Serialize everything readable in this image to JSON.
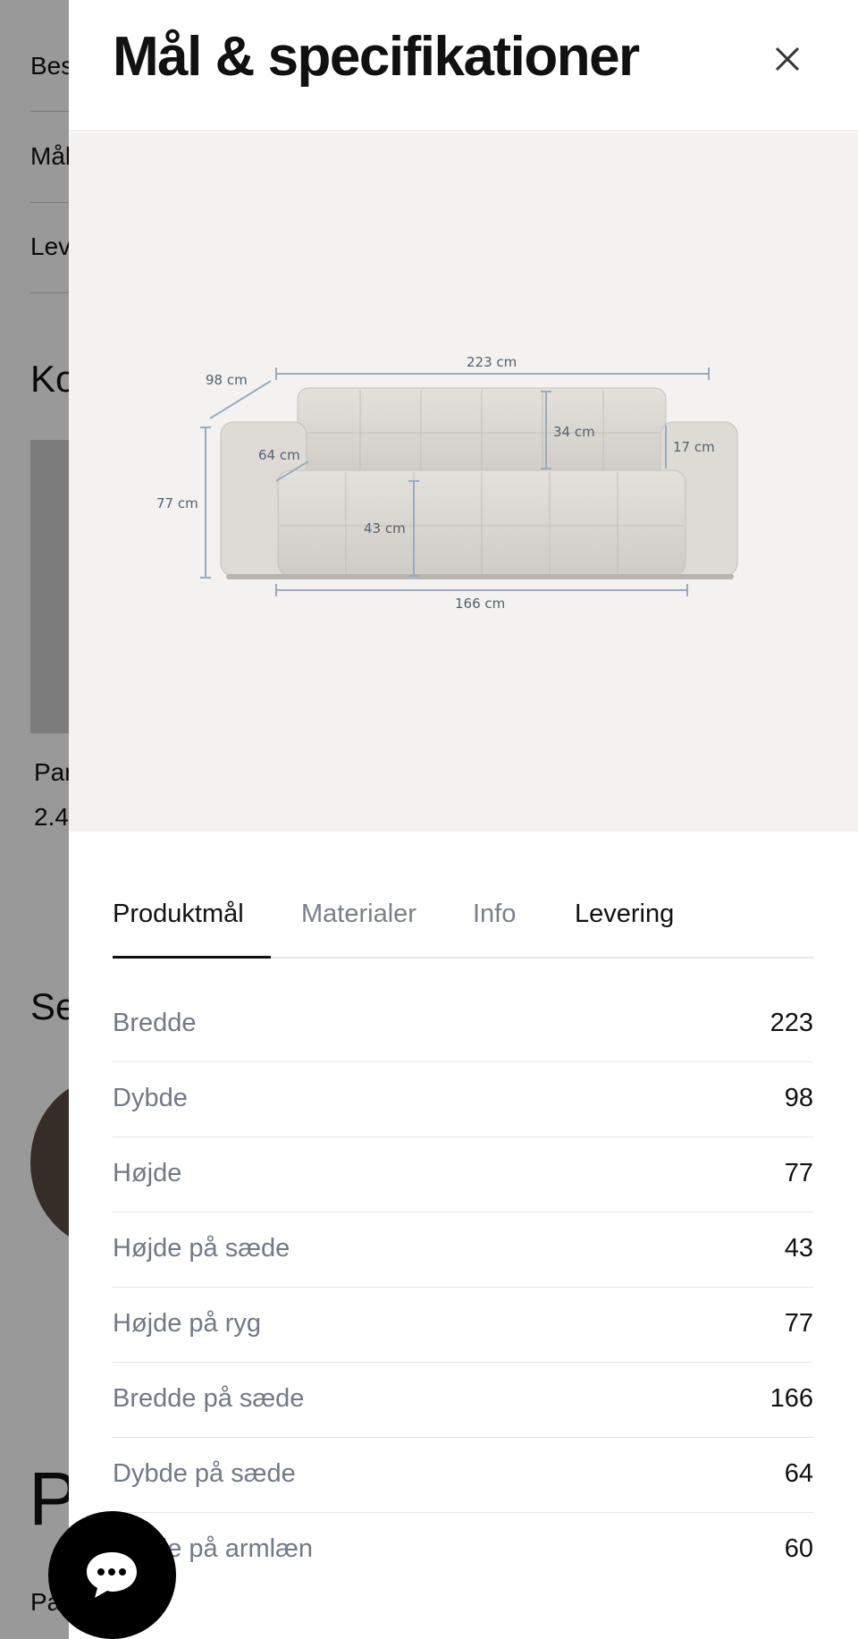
{
  "background_page": {
    "items": [
      "Bes",
      "Mål",
      "Lev"
    ],
    "heading_1": "Ko",
    "card_title": "Par",
    "card_price": "2.4",
    "heading_2": "Se",
    "big_text": "P",
    "bottom_text": "Pa"
  },
  "drawer": {
    "title": "Mål & specifikationer",
    "close_icon": "close-icon"
  },
  "diagram": {
    "labels": {
      "width": "223 cm",
      "depth": "98 cm",
      "seat_depth": "64 cm",
      "back_height": "34 cm",
      "arm_height": "17 cm",
      "height": "77 cm",
      "seat_height": "43 cm",
      "seat_width": "166 cm"
    }
  },
  "tabs": [
    {
      "label": "Produktmål",
      "active": true
    },
    {
      "label": "Materialer",
      "active": false
    },
    {
      "label": "Info",
      "active": false
    },
    {
      "label": "Levering",
      "active": false
    }
  ],
  "specs": [
    {
      "label": "Bredde",
      "value": "223"
    },
    {
      "label": "Dybde",
      "value": "98"
    },
    {
      "label": "Højde",
      "value": "77"
    },
    {
      "label": "Højde på sæde",
      "value": "43"
    },
    {
      "label": "Højde på ryg",
      "value": "77"
    },
    {
      "label": "Bredde på sæde",
      "value": "166"
    },
    {
      "label": "Dybde på sæde",
      "value": "64"
    },
    {
      "label": "Højde på armlæn",
      "value": "60"
    }
  ],
  "chat": {
    "icon": "chat-bubble-icon"
  },
  "colors": {
    "accent": "#111111",
    "muted": "#727887",
    "image_bg": "#f3f2f0",
    "dim_line": "#9aabc0"
  }
}
